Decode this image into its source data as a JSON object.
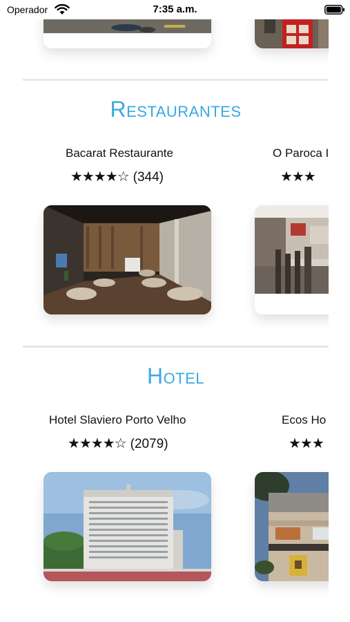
{
  "status_bar": {
    "carrier": "Operador",
    "time": "7:35 a.m.",
    "wifi_icon": "wifi-icon",
    "battery_icon": "battery-icon"
  },
  "sections": [
    {
      "title": "Restaurantes",
      "accent_color": "#39a9e3",
      "places": [
        {
          "name": "Bacarat Restaurante",
          "stars": "★★★★☆",
          "rating": 4.5,
          "reviews": "(344)"
        },
        {
          "name": "O Paroca I",
          "stars": "★★★",
          "rating": 4.5,
          "reviews": ""
        }
      ]
    },
    {
      "title": "Hotel",
      "accent_color": "#39a9e3",
      "places": [
        {
          "name": "Hotel Slaviero Porto Velho",
          "stars": "★★★★☆",
          "rating": 4.5,
          "reviews": "(2079)"
        },
        {
          "name": "Ecos Ho",
          "stars": "★★★",
          "rating": 4.5,
          "reviews": ""
        }
      ]
    }
  ]
}
